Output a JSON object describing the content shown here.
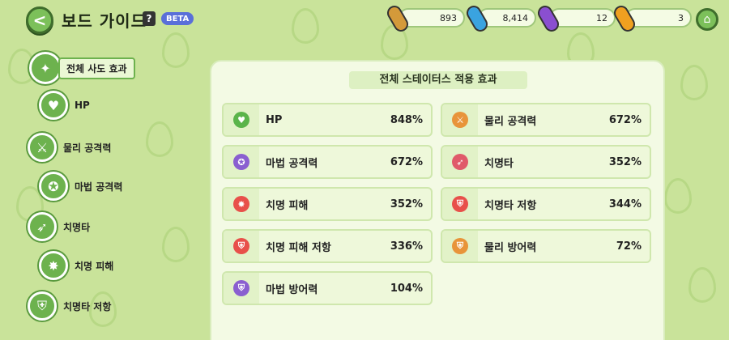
{
  "header": {
    "title": "보드 가이드",
    "help_label": "?",
    "beta_label": "BETA",
    "back_label": "<",
    "home_label": "⌂"
  },
  "currencies": [
    {
      "name": "orange-pill",
      "value": "893",
      "color": "#d49a3a"
    },
    {
      "name": "blue-pill",
      "value": "8,414",
      "color": "#3aa3e0"
    },
    {
      "name": "purple-pill",
      "value": "12",
      "color": "#8a4fd0"
    },
    {
      "name": "gold-pill",
      "value": "3",
      "color": "#f0a020"
    }
  ],
  "sidebar": {
    "items": [
      {
        "label": "전체 사도 효과",
        "icon": "all-effects-icon",
        "glyph": "✦"
      },
      {
        "label": "HP",
        "icon": "heart-icon",
        "glyph": "♥"
      },
      {
        "label": "물리 공격력",
        "icon": "sword-icon",
        "glyph": "⚔"
      },
      {
        "label": "마법 공격력",
        "icon": "magic-wand-icon",
        "glyph": "✪"
      },
      {
        "label": "치명타",
        "icon": "critical-icon",
        "glyph": "➶"
      },
      {
        "label": "치명 피해",
        "icon": "critical-damage-icon",
        "glyph": "✸"
      },
      {
        "label": "치명타 저항",
        "icon": "critical-resist-icon",
        "glyph": "⛨"
      }
    ]
  },
  "panel": {
    "title": "전체 스테이터스 적용 효과",
    "stats": [
      {
        "name": "HP",
        "value": "848%",
        "icon": "heart-icon",
        "color": "#5ab44a",
        "glyph": "♥"
      },
      {
        "name": "물리 공격력",
        "value": "672%",
        "icon": "sword-icon",
        "color": "#e8943a",
        "glyph": "⚔"
      },
      {
        "name": "마법 공격력",
        "value": "672%",
        "icon": "magic-wand-icon",
        "color": "#8a5fd0",
        "glyph": "✪"
      },
      {
        "name": "치명타",
        "value": "352%",
        "icon": "critical-icon",
        "color": "#e05a6a",
        "glyph": "➶"
      },
      {
        "name": "치명 피해",
        "value": "352%",
        "icon": "critical-damage-icon",
        "color": "#e8504a",
        "glyph": "✸"
      },
      {
        "name": "치명타 저항",
        "value": "344%",
        "icon": "critical-resist-icon",
        "color": "#e8504a",
        "glyph": "⛨"
      },
      {
        "name": "치명 피해 저항",
        "value": "336%",
        "icon": "critical-damage-resist-icon",
        "color": "#e8504a",
        "glyph": "⛨"
      },
      {
        "name": "물리 방어력",
        "value": "72%",
        "icon": "physical-defense-icon",
        "color": "#e8943a",
        "glyph": "⛨"
      },
      {
        "name": "마법 방어력",
        "value": "104%",
        "icon": "magic-defense-icon",
        "color": "#8a5fd0",
        "glyph": "⛨"
      }
    ]
  }
}
